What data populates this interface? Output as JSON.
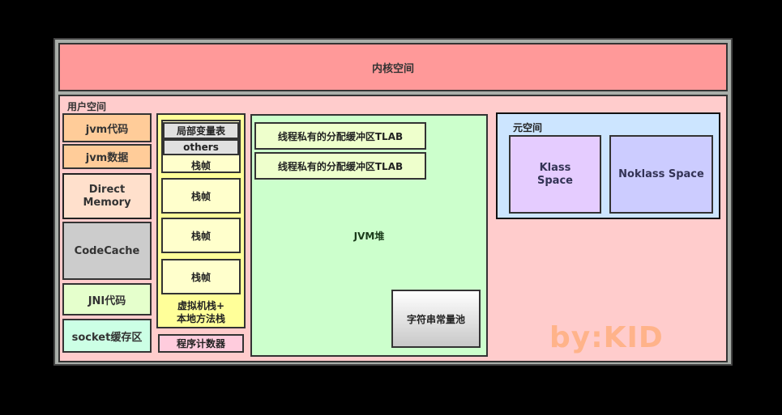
{
  "kernel_space": "内核空间",
  "user_space": {
    "label": "用户空间",
    "left_column": [
      "jvm代码",
      "jvm数据",
      "Direct\nMemory",
      "CodeCache",
      "JNI代码",
      "socket缓存区"
    ],
    "direct_memory": [
      "Direct",
      "Memory"
    ],
    "vm_stack": {
      "frame_top": {
        "local_vars": "局部变量表",
        "others": "others",
        "label": "栈帧"
      },
      "frames": [
        "栈帧",
        "栈帧",
        "栈帧"
      ],
      "label_line1": "虚拟机栈+",
      "label_line2": "本地方法栈"
    },
    "program_counter": "程序计数器",
    "heap": {
      "tlabs": [
        "线程私有的分配缓冲区TLAB",
        "线程私有的分配缓冲区TLAB"
      ],
      "label": "JVM堆",
      "string_pool": "字符串常量池"
    },
    "metaspace": {
      "label": "元空间",
      "klass_line1": "Klass",
      "klass_line2": "Space",
      "noklass": "Noklass Space"
    },
    "watermark": "by:KID"
  },
  "colors": {
    "kernel": "#ff9999",
    "user": "#ffcccc",
    "heap": "#ccffcc",
    "metaspace": "#cce5ff",
    "vm_stack": "#ffff99",
    "watermark": "#ffb38a"
  }
}
